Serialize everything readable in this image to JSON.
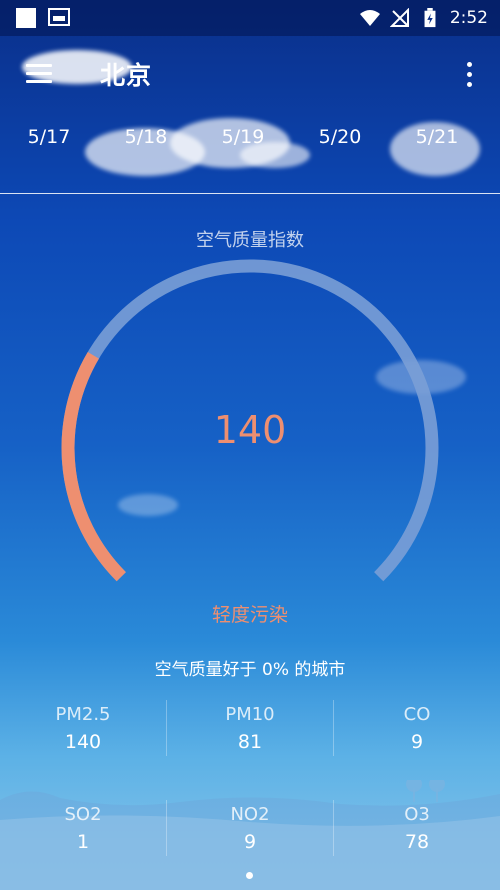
{
  "status_bar": {
    "time": "2:52"
  },
  "header": {
    "city": "北京",
    "dates": [
      "5/17",
      "5/18",
      "5/19",
      "5/20",
      "5/21"
    ]
  },
  "aqi": {
    "title": "空气质量指数",
    "value": "140",
    "level": "轻度污染",
    "comparison": "空气质量好于 0% 的城市",
    "gauge_fraction": 0.28,
    "colors": {
      "level": "#ee8f70",
      "track": "#7a9fd6"
    }
  },
  "pollutants": [
    {
      "name": "PM2.5",
      "value": "140"
    },
    {
      "name": "PM10",
      "value": "81"
    },
    {
      "name": "CO",
      "value": "9"
    },
    {
      "name": "SO2",
      "value": "1"
    },
    {
      "name": "NO2",
      "value": "9"
    },
    {
      "name": "O3",
      "value": "78"
    }
  ],
  "pager": {
    "pages": 1,
    "active": 0
  }
}
